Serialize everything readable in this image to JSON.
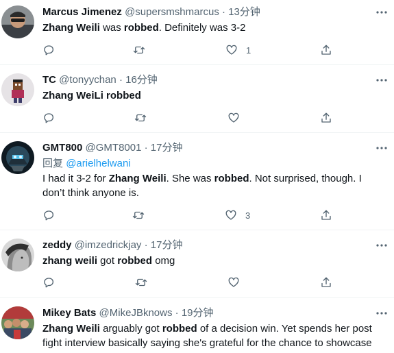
{
  "tweets": [
    {
      "name": "Marcus Jimenez",
      "handle": "@supersmshmarcus",
      "time": "13分钟",
      "reply_prefix": "",
      "reply_handle": "",
      "segments": [
        {
          "t": "Zhang Weili",
          "b": true
        },
        {
          "t": " was ",
          "b": false
        },
        {
          "t": "robbed",
          "b": true
        },
        {
          "t": ". Definitely was 3-2",
          "b": false
        }
      ],
      "likes": "1",
      "avatar_colors": [
        "#7d7d7d",
        "#3d3d3d"
      ]
    },
    {
      "name": "TC",
      "handle": "@tonyychan",
      "time": "16分钟",
      "reply_prefix": "",
      "reply_handle": "",
      "segments": [
        {
          "t": "Zhang WeiLi robbed",
          "b": true
        }
      ],
      "likes": "",
      "avatar_colors": [
        "#e9e6e6",
        "#b03a5a"
      ]
    },
    {
      "name": "GMT800",
      "handle": "@GMT8001",
      "time": "17分钟",
      "reply_prefix": "回复",
      "reply_handle": "@arielhelwani",
      "segments": [
        {
          "t": "I had it 3-2 for ",
          "b": false
        },
        {
          "t": "Zhang Weili",
          "b": true
        },
        {
          "t": ". She was ",
          "b": false
        },
        {
          "t": "robbed",
          "b": true
        },
        {
          "t": ". Not surprised, though. I don’t think anyone is.",
          "b": false
        }
      ],
      "likes": "3",
      "avatar_colors": [
        "#1b2a33",
        "#3f7c9a"
      ]
    },
    {
      "name": "zeddy",
      "handle": "@imzedrickjay",
      "time": "17分钟",
      "reply_prefix": "",
      "reply_handle": "",
      "segments": [
        {
          "t": "zhang weili",
          "b": true
        },
        {
          "t": " got ",
          "b": false
        },
        {
          "t": "robbed",
          "b": true
        },
        {
          "t": " omg",
          "b": false
        }
      ],
      "likes": "",
      "avatar_colors": [
        "#c9c9c9",
        "#4a4a4a"
      ]
    },
    {
      "name": "Mikey Bats",
      "handle": "@MikeJBknows",
      "time": "19分钟",
      "reply_prefix": "",
      "reply_handle": "",
      "segments": [
        {
          "t": "Zhang Weili",
          "b": true
        },
        {
          "t": " arguably got ",
          "b": false
        },
        {
          "t": "robbed",
          "b": true
        },
        {
          "t": " of a decision win. Yet spends her post fight interview basically saying she's grateful for the chance to showcase her ability in Madison Square Garden.",
          "b": false
        }
      ],
      "likes": "",
      "avatar_colors": [
        "#a23b3b",
        "#3c6a3a"
      ]
    }
  ]
}
